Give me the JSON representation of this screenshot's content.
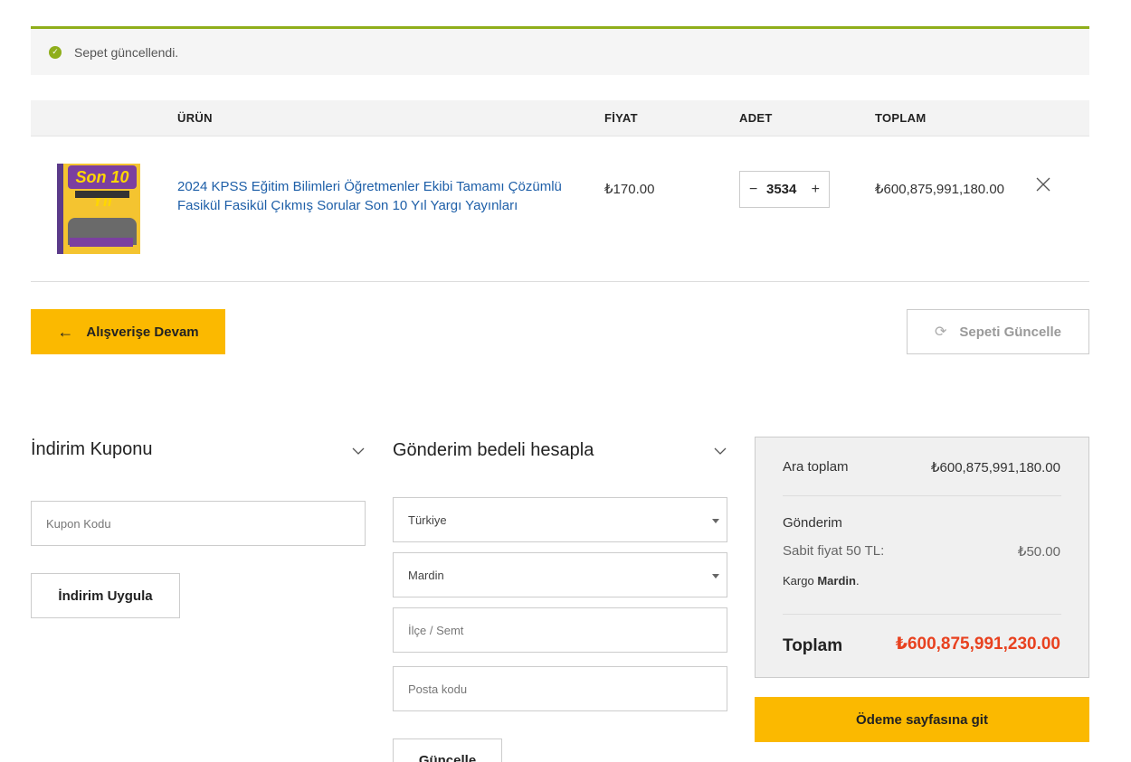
{
  "notice": {
    "message": "Sepet güncellendi."
  },
  "cart_table": {
    "headers": {
      "product": "ÜRÜN",
      "price": "FİYAT",
      "quantity": "ADET",
      "total": "TOPLAM"
    },
    "items": [
      {
        "name": "2024 KPSS Eğitim Bilimleri Öğretmenler Ekibi Tamamı Çözümlü Fasikül Fasikül Çıkmış Sorular Son 10 Yıl Yargı Yayınları",
        "price": "₺170.00",
        "quantity": "3534",
        "total": "₺600,875,991,180.00",
        "thumb_text": "Son 10 Yıl"
      }
    ],
    "qty_minus": "−",
    "qty_plus": "+"
  },
  "actions": {
    "continue_label": "Alışverişe Devam",
    "update_cart_label": "Sepeti Güncelle"
  },
  "coupon": {
    "title": "İndirim Kuponu",
    "placeholder": "Kupon Kodu",
    "apply_label": "İndirim Uygula"
  },
  "shipping_calc": {
    "title": "Gönderim bedeli hesapla",
    "country": "Türkiye",
    "city": "Mardin",
    "district_placeholder": "İlçe / Semt",
    "postcode_placeholder": "Posta kodu",
    "update_label": "Güncelle"
  },
  "totals": {
    "subtotal_label": "Ara toplam",
    "subtotal_value": "₺600,875,991,180.00",
    "shipping_label": "Gönderim",
    "flat_rate_label": "Sabit fiyat 50 TL:",
    "flat_rate_value": "₺50.00",
    "cargo_prefix": "Kargo",
    "cargo_city": "Mardin",
    "cargo_suffix": ".",
    "grand_label": "Toplam",
    "grand_value": "₺600,875,991,230.00"
  },
  "checkout": {
    "label": "Ödeme sayfasına git"
  },
  "colors": {
    "accent": "#fbb900",
    "success": "#8fae1b",
    "link": "#1e5fa8",
    "grand_total": "#e8411f"
  }
}
